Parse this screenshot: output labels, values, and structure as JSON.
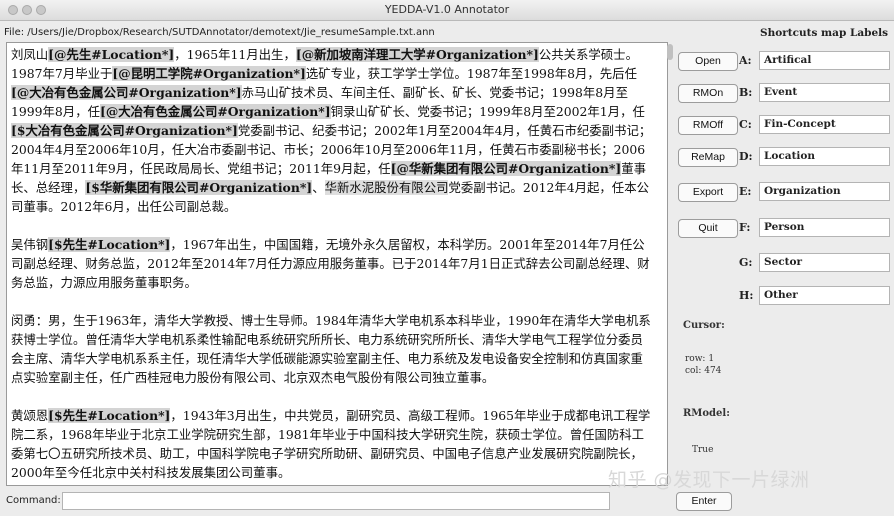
{
  "window": {
    "title": "YEDDA-V1.0 Annotator"
  },
  "file": {
    "path": "File: /Users/Jie/Dropbox/Research/SUTDAnnotator/demotext/Jie_resumeSample.txt.ann"
  },
  "editor": {
    "paragraphs": [
      [
        {
          "t": "刘凤山"
        },
        {
          "t": "[@先生#Location*]",
          "hl": 1
        },
        {
          "t": "，1965年11月出生，"
        },
        {
          "t": "[@新加坡南洋理工大学#Organization*]",
          "hl": 1
        },
        {
          "t": "公共关系学硕士。1987年7月毕业于"
        },
        {
          "t": "[@昆明工学院#Organization*]",
          "hl": 1
        },
        {
          "t": "选矿专业，获工学学士学位。1987年至1998年8月，先后任"
        },
        {
          "t": "[@大冶有色金属公司#Organization*]",
          "hl": 1
        },
        {
          "t": "赤马山矿技术员、车间主任、副矿长、矿长、党委书记；1998年8月至1999年8月，任"
        },
        {
          "t": "[@大冶有色金属公司#Organization*]",
          "hl": 1
        },
        {
          "t": "铜录山矿矿长、党委书记；1999年8月至2002年1月，任"
        },
        {
          "t": "[$大冶有色金属公司#Organization*]",
          "hl": 1
        },
        {
          "t": "党委副书记、纪委书记；2002年1月至2004年4月，任黄石市纪委副书记；2004年4月至2006年10月，任大冶市委副书记、市长；2006年10月至2006年11月，任黄石市委副秘书长；2006年11月至2011年9月，任民政局局长、党组书记；2011年9月起，任"
        },
        {
          "t": "[@华新集团有限公司#Organization*]",
          "hl": 1
        },
        {
          "t": "董事长、总经理，"
        },
        {
          "t": "[$华新集团有限公司#Organization*]",
          "hl": 1
        },
        {
          "t": "、"
        },
        {
          "t": "华新水泥股份有限公司",
          "hl": 2
        },
        {
          "t": "党委副书记。2012年4月起，任本公司董事。2012年6月，出任公司副总裁。"
        }
      ],
      [
        {
          "t": "吴伟钢"
        },
        {
          "t": "[$先生#Location*]",
          "hl": 1
        },
        {
          "t": "，1967年出生，中国国籍，无境外永久居留权，本科学历。2001年至2014年7月任公司副总经理、财务总监，2012年至2014年7月任力源应用服务董事。已于2014年7月1日正式辞去公司副总经理、财务总监，力源应用服务董事职务。"
        }
      ],
      [
        {
          "t": "闵勇：男，生于1963年，清华大学教授、博士生导师。1984年清华大学电机系本科毕业，1990年在清华大学电机系获博士学位。曾任清华大学电机系柔性输配电系统研究所所长、电力系统研究所所长、清华大学电气工程学位分委员会主席、清华大学电机系系主任，现任清华大学低碳能源实验室副主任、电力系统及发电设备安全控制和仿真国家重点实验室副主任，任广西桂冠电力股份有限公司、北京双杰电气股份有限公司独立董事。"
        }
      ],
      [
        {
          "t": "黄颂恩"
        },
        {
          "t": "[$先生#Location*]",
          "hl": 1
        },
        {
          "t": "，1943年3月出生，中共党员，副研究员、高级工程师。1965年毕业于成都电讯工程学院二系，1968年毕业于北京工业学院研究生部，1981年毕业于中国科技大学研究生院，获硕士学位。曾任国防科工委第七〇五研究所技术员、助工，中国科学院电子学研究所助研、副研究员、中国电子信息产业发展研究院副院长，2000年至今任北京中关村科技发展集团公司董事。"
        }
      ]
    ]
  },
  "buttons": [
    {
      "label": "Open"
    },
    {
      "label": "RMOn"
    },
    {
      "label": "RMOff"
    },
    {
      "label": "ReMap"
    },
    {
      "label": "Export"
    },
    {
      "label": "Quit"
    }
  ],
  "shortcuts": {
    "header": "Shortcuts map Labels",
    "rows": [
      {
        "key": "A:",
        "label": "Artifical"
      },
      {
        "key": "B:",
        "label": "Event"
      },
      {
        "key": "C:",
        "label": "Fin-Concept"
      },
      {
        "key": "D:",
        "label": "Location"
      },
      {
        "key": "E:",
        "label": "Organization"
      },
      {
        "key": "F:",
        "label": "Person"
      },
      {
        "key": "G:",
        "label": "Sector"
      },
      {
        "key": "H:",
        "label": "Other"
      }
    ]
  },
  "status": {
    "cursor_label": "Cursor:",
    "row": "row: 1",
    "col": "col: 474",
    "rmodel_label": "RModel:",
    "rmodel_value": "True"
  },
  "command": {
    "label": "Command:",
    "value": ""
  },
  "enter_label": "Enter",
  "watermark": "知乎 @发现下一片绿洲"
}
